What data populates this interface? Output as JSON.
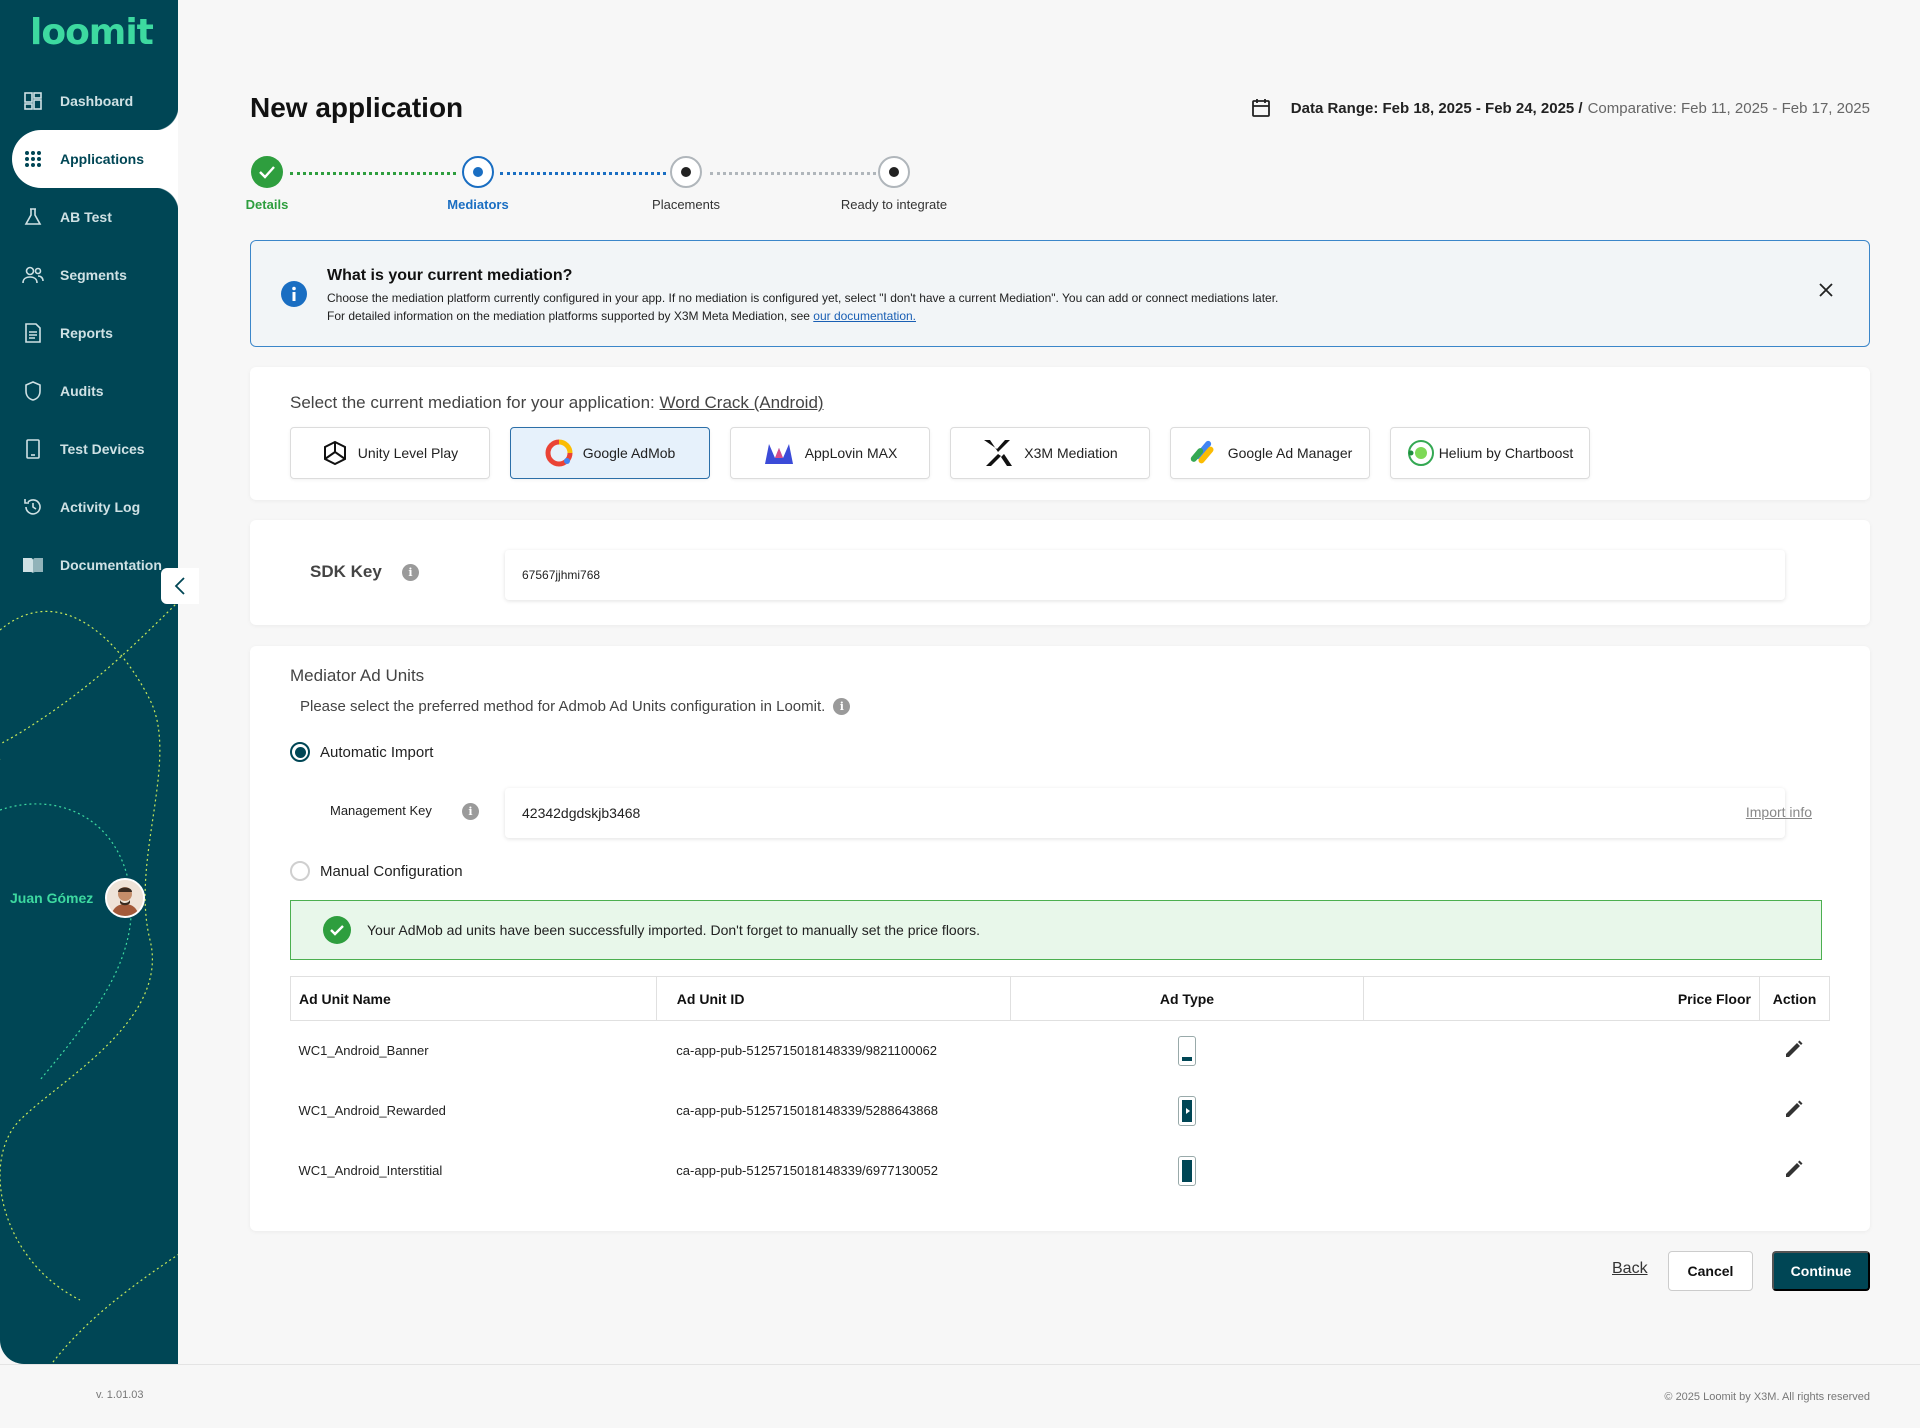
{
  "app": {
    "logo": "loomit",
    "version": "v. 1.01.03",
    "copyright": "© 2025 Loomit by X3M. All rights reserved"
  },
  "sidebar": {
    "items": [
      {
        "label": "Dashboard",
        "icon": "dashboard-icon"
      },
      {
        "label": "Applications",
        "icon": "grid-icon"
      },
      {
        "label": "AB Test",
        "icon": "flask-icon"
      },
      {
        "label": "Segments",
        "icon": "users-icon"
      },
      {
        "label": "Reports",
        "icon": "document-icon"
      },
      {
        "label": "Audits",
        "icon": "shield-icon"
      },
      {
        "label": "Test Devices",
        "icon": "phone-icon"
      },
      {
        "label": "Activity Log",
        "icon": "history-icon"
      },
      {
        "label": "Documentation",
        "icon": "book-icon"
      }
    ],
    "active": "Applications",
    "user_name": "Juan Gómez"
  },
  "header": {
    "title": "New application",
    "date_range_label": "Data Range: Feb 18, 2025 - Feb 24, 2025 /",
    "comparative_label": "Comparative: Feb 11, 2025 - Feb 17, 2025"
  },
  "stepper": {
    "steps": [
      {
        "label": "Details",
        "state": "done"
      },
      {
        "label": "Mediators",
        "state": "current"
      },
      {
        "label": "Placements",
        "state": "pending"
      },
      {
        "label": "Ready to integrate",
        "state": "pending"
      }
    ]
  },
  "info_banner": {
    "title": "What is your current mediation?",
    "line1": "Choose the mediation platform currently configured in your app. If no mediation is configured yet, select \"I don't have a current Mediation\". You can add or connect mediations later.",
    "line2": "For detailed information on the mediation platforms supported by X3M Meta Mediation,  see ",
    "link": "our documentation."
  },
  "mediation_select": {
    "prompt": "Select the current mediation for your application:",
    "app_name": "Word Crack (Android)",
    "options": [
      {
        "label": "Unity Level Play",
        "icon": "unity-icon"
      },
      {
        "label": "Google AdMob",
        "icon": "admob-icon"
      },
      {
        "label": "AppLovin MAX",
        "icon": "applovin-icon"
      },
      {
        "label": "X3M Mediation",
        "icon": "x3m-icon"
      },
      {
        "label": "Google Ad Manager",
        "icon": "google-ad-manager-icon"
      },
      {
        "label": "Helium by Chartboost",
        "icon": "helium-icon"
      }
    ],
    "selected": "Google AdMob"
  },
  "sdk": {
    "label": "SDK Key",
    "value": "67567jjhmi768"
  },
  "mediator_ad_units": {
    "title": "Mediator Ad Units",
    "description": "Please select the preferred method for Admob Ad Units configuration in Loomit.",
    "automatic_label": "Automatic Import",
    "manual_label": "Manual Configuration",
    "selected_method": "Automatic Import",
    "management_key_label": "Management Key",
    "management_key_value": "42342dgdskjb3468",
    "import_info": "Import info",
    "success_message": "Your AdMob ad units have been successfully imported. Don't forget to manually set the price floors."
  },
  "table": {
    "headers": [
      "Ad Unit Name",
      "Ad Unit ID",
      "Ad Type",
      "Price Floor",
      "Action"
    ],
    "rows": [
      {
        "name": "WC1_Android_Banner",
        "id": "ca-app-pub-5125715018148339/9821100062",
        "type": "banner"
      },
      {
        "name": "WC1_Android_Rewarded",
        "id": "ca-app-pub-5125715018148339/5288643868",
        "type": "rewarded"
      },
      {
        "name": "WC1_Android_Interstitial",
        "id": "ca-app-pub-5125715018148339/6977130052",
        "type": "interstitial"
      }
    ]
  },
  "actions": {
    "back": "Back",
    "cancel": "Cancel",
    "continue": "Continue"
  },
  "colors": {
    "primary": "#004655",
    "accent": "#3dd9a0",
    "success": "#2e9e3e",
    "info": "#1a6ec2"
  }
}
